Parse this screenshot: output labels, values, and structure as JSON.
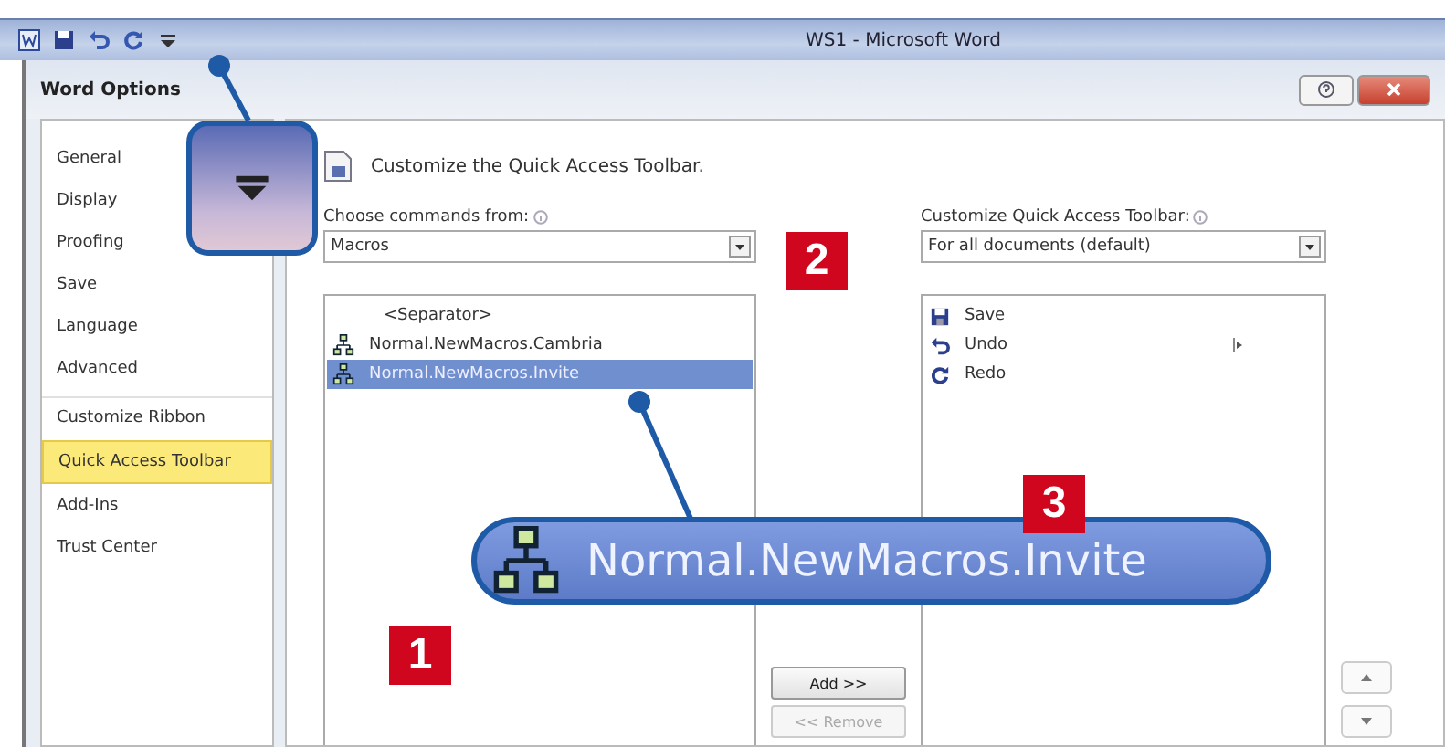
{
  "app_window": {
    "title": "WS1 - Microsoft Word"
  },
  "dialog": {
    "title": "Word Options"
  },
  "sidebar": {
    "items": [
      {
        "label": "General",
        "selected": false,
        "group_start": false
      },
      {
        "label": "Display",
        "selected": false,
        "group_start": false
      },
      {
        "label": "Proofing",
        "selected": false,
        "group_start": false
      },
      {
        "label": "Save",
        "selected": false,
        "group_start": false
      },
      {
        "label": "Language",
        "selected": false,
        "group_start": false
      },
      {
        "label": "Advanced",
        "selected": false,
        "group_start": false
      },
      {
        "label": "Customize Ribbon",
        "selected": false,
        "group_start": true
      },
      {
        "label": "Quick Access Toolbar",
        "selected": true,
        "group_start": false
      },
      {
        "label": "Add-Ins",
        "selected": false,
        "group_start": false
      },
      {
        "label": "Trust Center",
        "selected": false,
        "group_start": false
      }
    ]
  },
  "heading": "Customize the Quick Access Toolbar.",
  "commands_from": {
    "label": "Choose commands from:",
    "value": "Macros"
  },
  "commands_list": {
    "items": [
      {
        "kind": "separator",
        "label": "<Separator>",
        "selected": false
      },
      {
        "kind": "macro",
        "label": "Normal.NewMacros.Cambria",
        "selected": false
      },
      {
        "kind": "macro",
        "label": "Normal.NewMacros.Invite",
        "selected": true
      }
    ]
  },
  "toolbar_for": {
    "label": "Customize Quick Access Toolbar:",
    "value": "For all documents (default)"
  },
  "toolbar_list": {
    "items": [
      {
        "kind": "save",
        "label": "Save",
        "submenu": false
      },
      {
        "kind": "undo",
        "label": "Undo",
        "submenu": true
      },
      {
        "kind": "redo",
        "label": "Redo",
        "submenu": false
      }
    ]
  },
  "buttons": [
    {
      "label": "Add >>",
      "disabled": false
    },
    {
      "label": "<< Remove",
      "disabled": true
    }
  ],
  "callouts": {
    "magnified_label": "Normal.NewMacros.Invite",
    "steps": [
      "1",
      "2",
      "3"
    ]
  }
}
